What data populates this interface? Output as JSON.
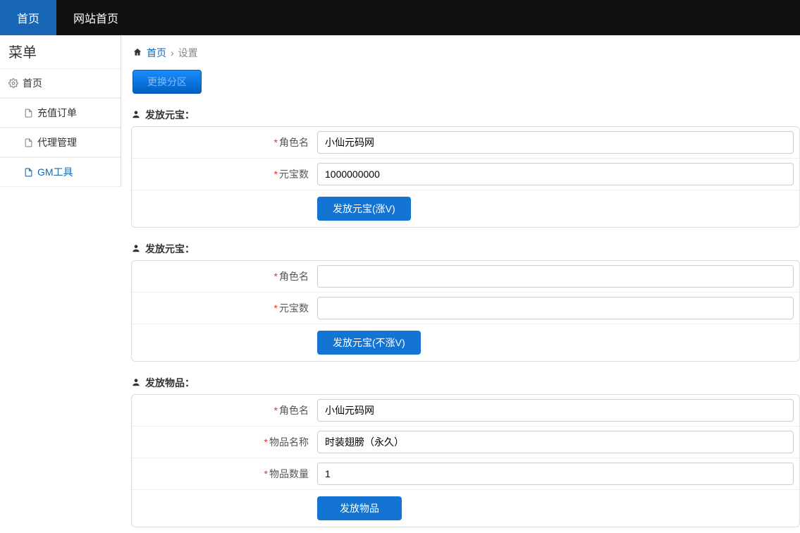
{
  "topnav": {
    "tab_home": "首页",
    "tab_site_home": "网站首页"
  },
  "sidebar": {
    "title": "菜单",
    "root": "首页",
    "items": [
      {
        "label": "充值订单",
        "active": false
      },
      {
        "label": "代理管理",
        "active": false
      },
      {
        "label": "GM工具",
        "active": true
      }
    ]
  },
  "breadcrumb": {
    "home": "首页",
    "current": "设置"
  },
  "top_button": "更换分区",
  "section1": {
    "title": "发放元宝：",
    "role_label": "角色名",
    "role_value": "小仙元码网",
    "amount_label": "元宝数",
    "amount_value": "1000000000",
    "submit": "发放元宝(涨V)"
  },
  "section2": {
    "title": "发放元宝：",
    "role_label": "角色名",
    "role_value": "",
    "amount_label": "元宝数",
    "amount_value": "",
    "submit": "发放元宝(不涨V)"
  },
  "section3": {
    "title": "发放物品：",
    "role_label": "角色名",
    "role_value": "小仙元码网",
    "item_label": "物品名称",
    "item_value": "时装翅膀（永久）",
    "qty_label": "物品数量",
    "qty_value": "1",
    "submit": "发放物品"
  }
}
